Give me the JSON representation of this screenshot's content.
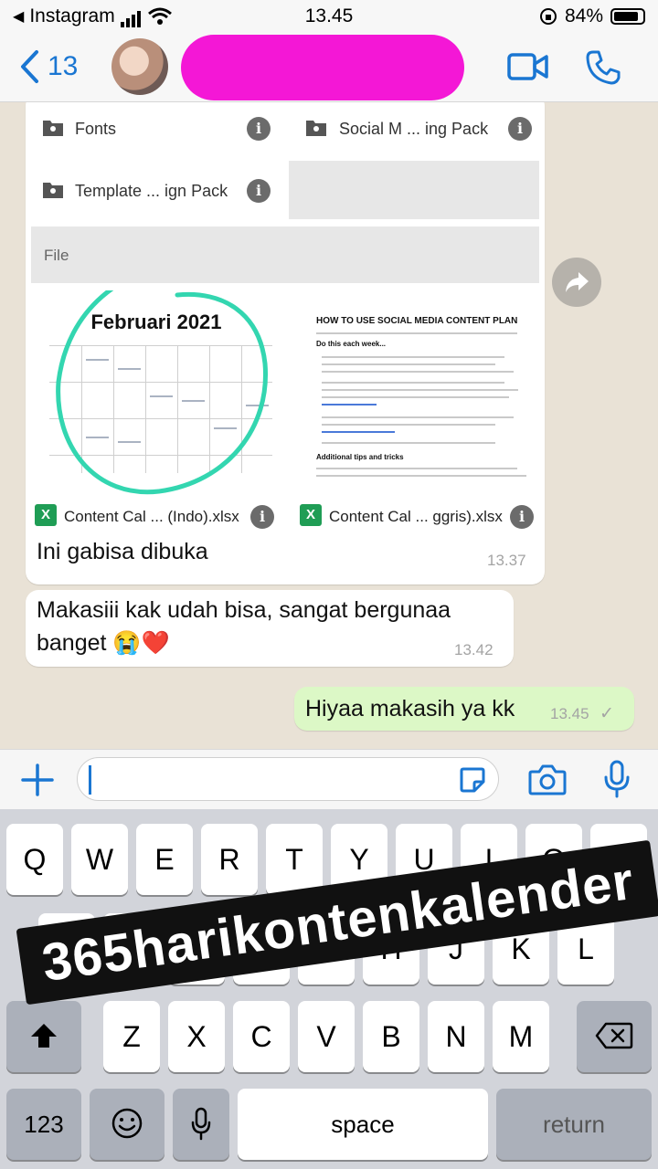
{
  "status_bar": {
    "carrier": "Instagram",
    "time": "13.45",
    "battery": "84%"
  },
  "header": {
    "back_count": "13"
  },
  "shared_folders": [
    {
      "label": "Fonts"
    },
    {
      "label": "Social M ... ing Pack"
    },
    {
      "label": "Template ... ign Pack"
    }
  ],
  "file_section_label": "File",
  "files": [
    {
      "name": "Content Cal ... (Indo).xlsx",
      "preview_title": "Februari 2021"
    },
    {
      "name": "Content Cal ... ggris).xlsx",
      "preview_title": "HOW TO USE SOCIAL MEDIA CONTENT PLAN",
      "preview_heading_1": "Do this each week...",
      "preview_heading_2": "Additional tips and tricks"
    }
  ],
  "messages": [
    {
      "direction": "incoming",
      "text": "Ini gabisa dibuka",
      "time": "13.37"
    },
    {
      "direction": "incoming",
      "text_line1": "Makasiii kak udah bisa, sangat bergunaa",
      "text_line2": "banget 😭❤️",
      "time": "13.42"
    },
    {
      "direction": "outgoing",
      "text": "Hiyaa makasih ya kk",
      "time": "13.45",
      "status": "✓"
    }
  ],
  "keyboard": {
    "row1": [
      "Q",
      "W",
      "E",
      "R",
      "T",
      "Y",
      "U",
      "I",
      "O",
      "P"
    ],
    "row2": [
      "A",
      "S",
      "D",
      "F",
      "G",
      "H",
      "J",
      "K",
      "L"
    ],
    "row3": [
      "Z",
      "X",
      "C",
      "V",
      "B",
      "N",
      "M"
    ],
    "numbers_key": "123",
    "space_key": "space",
    "return_key": "return"
  },
  "sticker_text": "365harikontenkalender",
  "colors": {
    "accent_blue": "#1a76d2",
    "contact_highlight": "#f417d6",
    "outgoing_bubble": "#dcf8c6",
    "circle_annotation": "#33d6b0",
    "excel_green": "#1f9d55"
  }
}
